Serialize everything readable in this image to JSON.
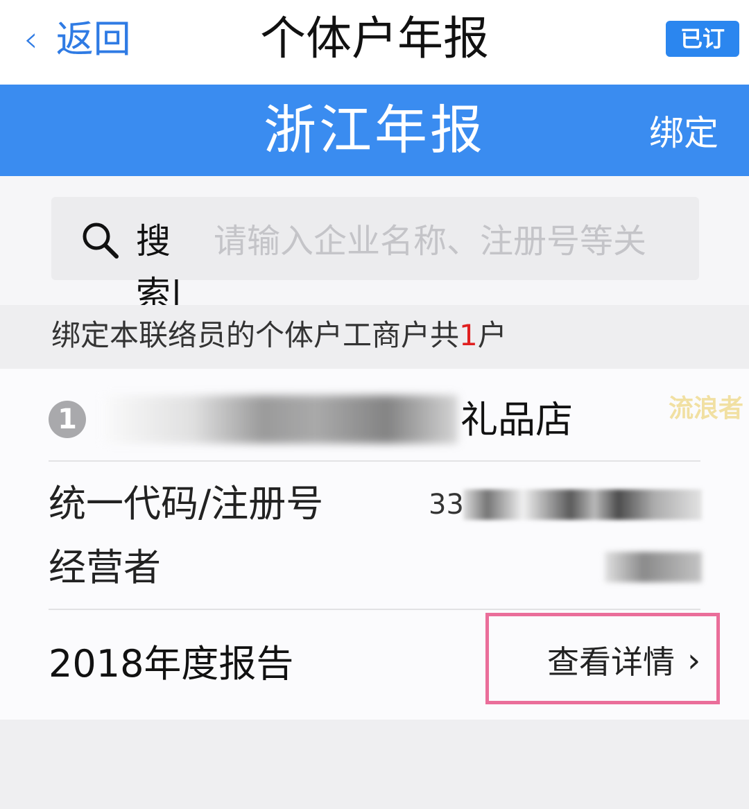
{
  "nav": {
    "back_icon": "chevron-left",
    "back_label": "返回",
    "title": "个体户年报",
    "subscribed_label": "已订"
  },
  "header": {
    "title": "浙江年报",
    "bind_label": "绑定"
  },
  "search": {
    "label": "搜索|",
    "placeholder": "请输入企业名称、注册号等关",
    "value": ""
  },
  "summary": {
    "prefix": "绑定本联络员的个体户工商户共",
    "count": "1",
    "suffix": "户"
  },
  "business": {
    "index": "1",
    "name_suffix": "礼品店",
    "code_label": "统一代码/注册号",
    "code_prefix": "33",
    "operator_label": "经营者",
    "report_title": "2018年度报告",
    "detail_label": "查看详情",
    "detail_icon": "chevron-right"
  },
  "watermark": "流浪者",
  "colors": {
    "accent_blue": "#3a8cf0",
    "back_blue": "#2f7be4",
    "count_red": "#e02020",
    "highlight_pink": "#ea6e9a"
  }
}
